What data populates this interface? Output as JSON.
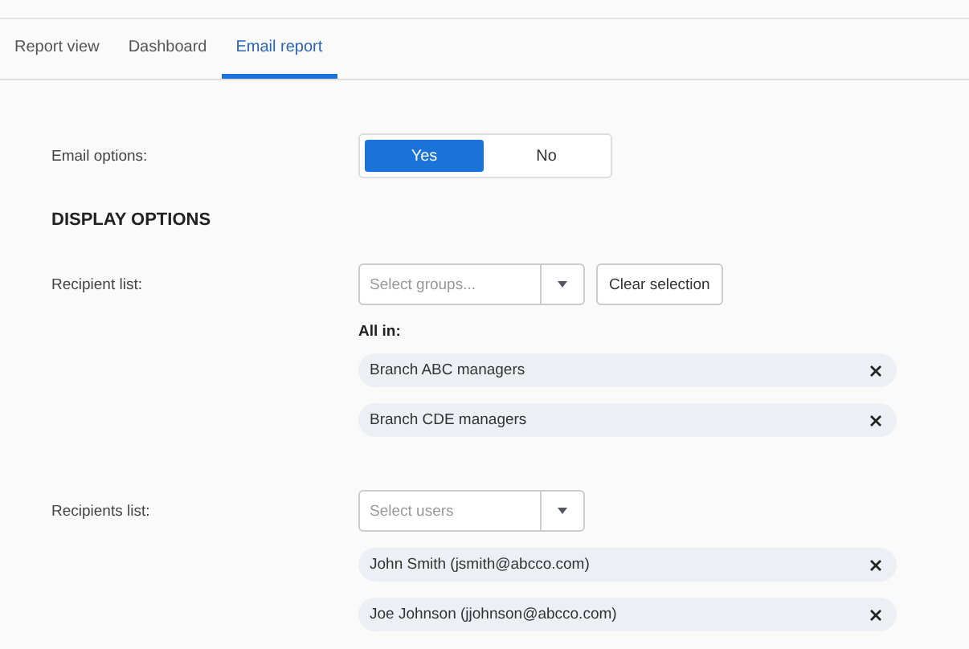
{
  "tabs": [
    {
      "label": "Report view",
      "selected": false
    },
    {
      "label": "Dashboard",
      "selected": false
    },
    {
      "label": "Email report",
      "selected": true
    }
  ],
  "email_options": {
    "label": "Email options:",
    "choices": [
      {
        "label": "Yes",
        "selected": true
      },
      {
        "label": "No",
        "selected": false
      }
    ]
  },
  "section_title": "DISPLAY OPTIONS",
  "recipient_list": {
    "label": "Recipient list:",
    "select": {
      "placeholder": "Select groups..."
    },
    "clear_button": "Clear selection",
    "heading": "All in:",
    "chips": [
      "Branch ABC managers",
      "Branch CDE managers"
    ]
  },
  "recipients_list": {
    "label": "Recipients list:",
    "select": {
      "placeholder": "Select users"
    },
    "chips": [
      "John Smith (jsmith@abcco.com)",
      "Joe Johnson (jjohnson@abcco.com)"
    ]
  }
}
